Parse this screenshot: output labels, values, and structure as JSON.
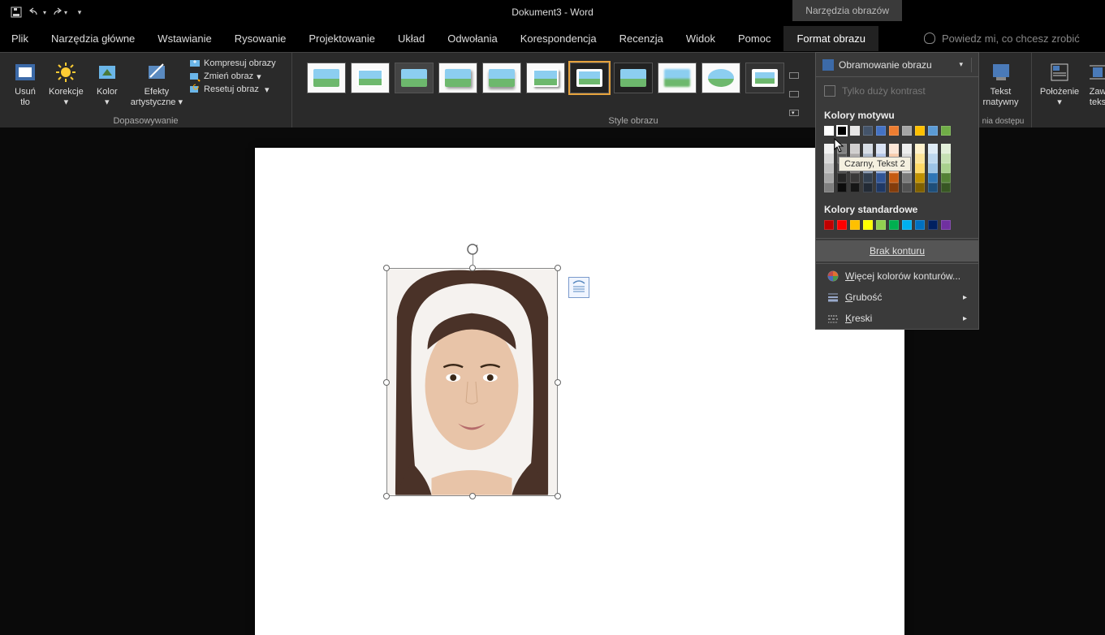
{
  "titlebar": {
    "title": "Dokument3 - Word",
    "context_tab": "Narzędzia obrazów"
  },
  "tabs": {
    "file": "Plik",
    "home": "Narzędzia główne",
    "insert": "Wstawianie",
    "draw": "Rysowanie",
    "design": "Projektowanie",
    "layout": "Układ",
    "references": "Odwołania",
    "mailings": "Korespondencja",
    "review": "Recenzja",
    "view": "Widok",
    "help": "Pomoc",
    "format": "Format obrazu"
  },
  "tell_me": {
    "placeholder": "Powiedz mi, co chcesz zrobić"
  },
  "adjust": {
    "remove_bg_1": "Usuń",
    "remove_bg_2": "tło",
    "corrections": "Korekcje",
    "color": "Kolor",
    "artistic_1": "Efekty",
    "artistic_2": "artystyczne",
    "compress": "Kompresuj obrazy",
    "change": "Zmień obraz",
    "reset": "Resetuj obraz",
    "group_label": "Dopasowywanie"
  },
  "styles": {
    "group_label": "Style obrazu"
  },
  "border_dd": {
    "title": "Obramowanie obrazu",
    "high_contrast": "Tylko duży kontrast",
    "theme_colors": "Kolory motywu",
    "standard_colors": "Kolory standardowe",
    "no_outline": "Brak konturu",
    "more_colors": "Więcej kolorów konturów...",
    "weight": "Grubość",
    "dashes": "Kreski",
    "tooltip": "Czarny, Tekst 2",
    "theme_row": [
      "#ffffff",
      "#000000",
      "#e7e6e6",
      "#44546a",
      "#4472c4",
      "#ed7d31",
      "#a5a5a5",
      "#ffc000",
      "#5b9bd5",
      "#70ad47"
    ],
    "shades": [
      [
        "#f2f2f2",
        "#7f7f7f",
        "#d0cece",
        "#d6dce4",
        "#d9e2f3",
        "#fbe5d5",
        "#ededed",
        "#fff2cc",
        "#deebf6",
        "#e2efd9"
      ],
      [
        "#d8d8d8",
        "#595959",
        "#aeabab",
        "#adb9ca",
        "#b4c6e7",
        "#f7cbac",
        "#dbdbdb",
        "#fee599",
        "#bdd7ee",
        "#c5e0b3"
      ],
      [
        "#bfbfbf",
        "#3f3f3f",
        "#757070",
        "#8496b0",
        "#8eaadb",
        "#f4b183",
        "#c9c9c9",
        "#ffd965",
        "#9cc3e5",
        "#a8d08d"
      ],
      [
        "#a5a5a5",
        "#262626",
        "#3a3838",
        "#323f4f",
        "#2f5496",
        "#c55a11",
        "#7b7b7b",
        "#bf9000",
        "#2e75b5",
        "#538135"
      ],
      [
        "#7f7f7f",
        "#0c0c0c",
        "#161616",
        "#222a35",
        "#1f3864",
        "#833c0b",
        "#525252",
        "#7f6000",
        "#1e4e79",
        "#375623"
      ]
    ],
    "standard_row": [
      "#c00000",
      "#ff0000",
      "#ffc000",
      "#ffff00",
      "#92d050",
      "#00b050",
      "#00b0f0",
      "#0070c0",
      "#002060",
      "#7030a0"
    ]
  },
  "right_group": {
    "alt_text_1": "Tekst",
    "alt_text_2": "rnatywny",
    "accessibility": "nia dostępu",
    "position": "Położenie",
    "wrap_1": "Zaw",
    "wrap_2": "teks"
  }
}
